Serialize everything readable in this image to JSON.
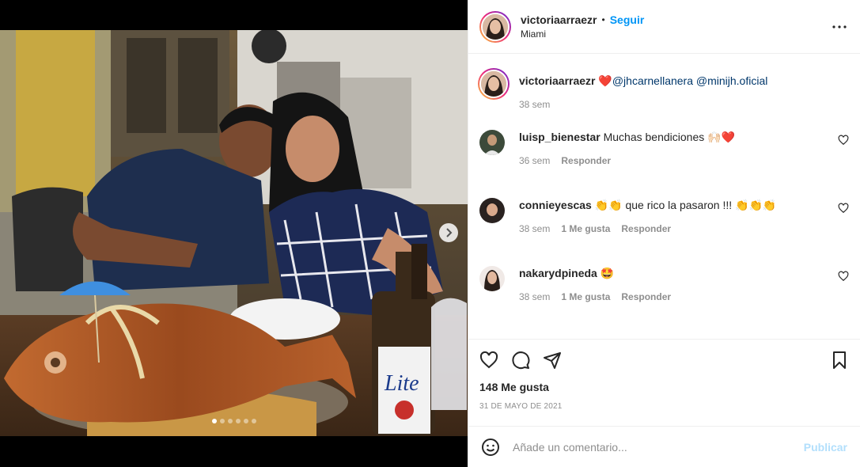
{
  "post": {
    "username": "victoriaarraezr",
    "separator": "•",
    "follow_label": "Seguir",
    "location": "Miami",
    "more_icon": "more-horizontal-icon",
    "media": {
      "slide_count": 6,
      "active_slide": 1
    }
  },
  "caption": {
    "username": "victoriaarraezr",
    "heart": "❤️",
    "mentions": [
      "@jhcarnellanera",
      "@minijh.oficial"
    ],
    "time": "38 sem"
  },
  "comments": [
    {
      "username": "luisp_bienestar",
      "text": "Muchas bendiciones 🙌🏻❤️",
      "time": "36 sem",
      "likes_label": "",
      "reply_label": "Responder"
    },
    {
      "username": "connieyescas",
      "text": "👏👏 que rico la pasaron !!! 👏👏👏",
      "time": "38 sem",
      "likes_label": "1 Me gusta",
      "reply_label": "Responder"
    },
    {
      "username": "nakarydpineda",
      "text": "🤩",
      "time": "38 sem",
      "likes_label": "1 Me gusta",
      "reply_label": "Responder"
    }
  ],
  "actions": {
    "likes": "148 Me gusta",
    "date": "31 DE MAYO DE 2021"
  },
  "add_comment": {
    "placeholder": "Añade un comentario...",
    "publish_label": "Publicar"
  },
  "colors": {
    "accent": "#0095f6",
    "publish_disabled": "#b2dffc",
    "muted": "#8e8e8e",
    "mention": "#00376b"
  }
}
